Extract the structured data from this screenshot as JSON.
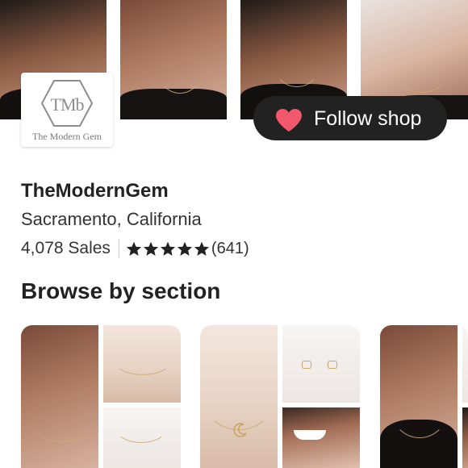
{
  "banner": {
    "photos": [
      "banner-photo-1",
      "banner-photo-2",
      "banner-photo-3",
      "banner-photo-4"
    ]
  },
  "logo": {
    "monogram": "TMb",
    "caption": "The Modern Gem"
  },
  "follow": {
    "label": "Follow shop",
    "icon": "heart-icon",
    "heart_color": "#f1586b"
  },
  "shop": {
    "name": "TheModernGem",
    "location": "Sacramento, California",
    "sales": "4,078 Sales",
    "rating_stars": 5,
    "review_count": "(641)"
  },
  "sections": {
    "heading": "Browse by section"
  },
  "colors": {
    "button_bg": "#222222",
    "text": "#222222"
  }
}
